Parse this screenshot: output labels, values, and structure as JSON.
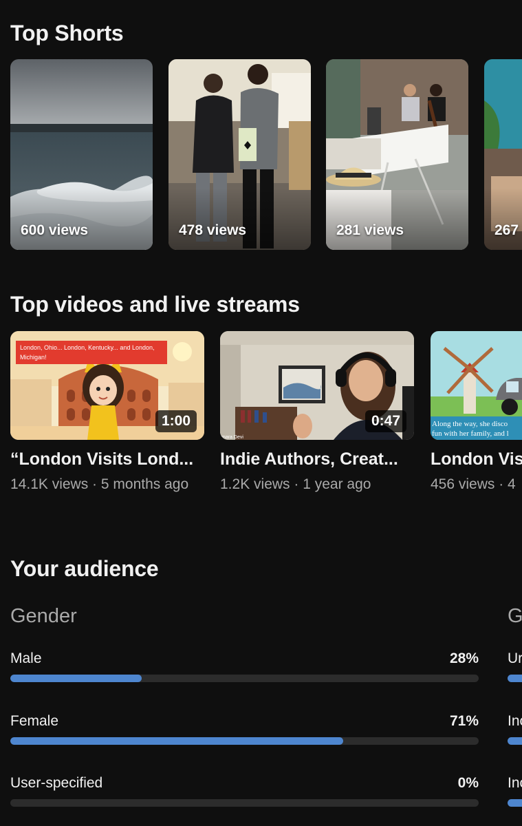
{
  "shorts": {
    "title": "Top Shorts",
    "items": [
      {
        "views": "600 views"
      },
      {
        "views": "478 views"
      },
      {
        "views": "281 views"
      },
      {
        "views": "267"
      }
    ]
  },
  "videos": {
    "title": "Top videos and live streams",
    "items": [
      {
        "title": "“London Visits Lond...",
        "meta": "14.1K views · 5 months ago",
        "duration": "1:00",
        "thumb_caption": "London, Ohio... London, Kentucky... and London, Michigan!"
      },
      {
        "title": "Indie Authors, Creat...",
        "meta": "1.2K views · 1 year ago",
        "duration": "0:47",
        "thumb_caption": "mara Devi"
      },
      {
        "title": "London Vis",
        "meta": "456 views · 4",
        "thumb_caption": "Along the way, she disco fun with her family, and l"
      }
    ]
  },
  "audience": {
    "title": "Your audience",
    "gender": {
      "title": "Gender",
      "rows": [
        {
          "label": "Male",
          "percent_text": "28%",
          "value": 28
        },
        {
          "label": "Female",
          "percent_text": "71%",
          "value": 71
        },
        {
          "label": "User-specified",
          "percent_text": "0%",
          "value": 0
        }
      ]
    },
    "peek": {
      "title": "G",
      "labels": [
        "Ur",
        "Inc",
        "Inc"
      ]
    }
  },
  "colors": {
    "background": "#0f0f0f",
    "bar_fill": "#4e86cf",
    "bar_track": "#2c2c2c",
    "secondary_text": "#aaaaaa"
  }
}
